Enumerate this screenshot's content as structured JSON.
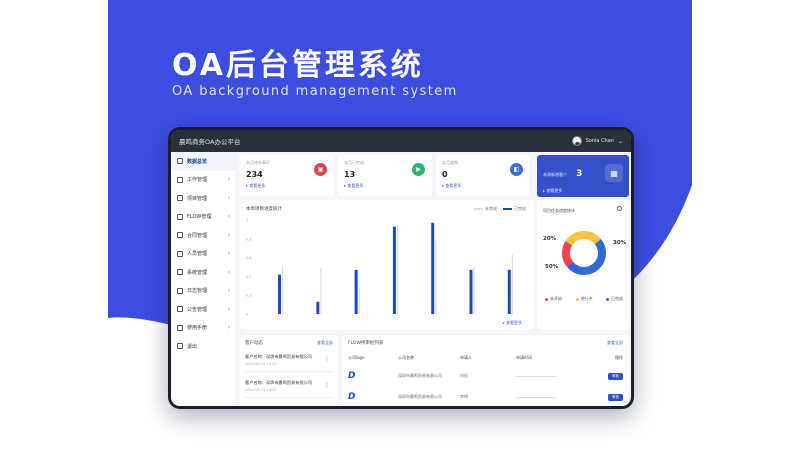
{
  "hero": {
    "title": "OA后台管理系统",
    "subtitle": "OA background management system"
  },
  "app": {
    "title": "晨鸣商务OA办公平台",
    "user": "Sonia Chan"
  },
  "sidebar": {
    "items": [
      {
        "label": "数据总览",
        "active": true,
        "arrow": ""
      },
      {
        "label": "工作管理",
        "arrow": "›"
      },
      {
        "label": "项目管理",
        "arrow": "›"
      },
      {
        "label": "FLOW管理",
        "arrow": "›"
      },
      {
        "label": "合同管理",
        "arrow": "›"
      },
      {
        "label": "人员管理",
        "arrow": "›"
      },
      {
        "label": "系统管理",
        "arrow": "›"
      },
      {
        "label": "日志管理",
        "arrow": "›"
      },
      {
        "label": "公告管理",
        "arrow": "›"
      },
      {
        "label": "使用手册",
        "arrow": "›"
      },
      {
        "label": "退出",
        "arrow": ""
      }
    ]
  },
  "stats": [
    {
      "label": "本月待办事项",
      "value": "234",
      "link": "▸ 查看更多",
      "color": "#e0454f",
      "glyph": "▣"
    },
    {
      "label": "本月已完成",
      "value": "13",
      "link": "▸ 查看更多",
      "color": "#2fb36d",
      "glyph": "▶"
    },
    {
      "label": "本月逾期",
      "value": "0",
      "link": "▸ 查看更多",
      "color": "#3a6fd8",
      "glyph": "◧"
    }
  ],
  "blue_card": {
    "label": "本周新增客户",
    "value": "3",
    "link": "▸ 查看更多",
    "glyph": "▦"
  },
  "chart_card": {
    "title": "本周项目进度统计",
    "legend": [
      "未完成",
      "已完成"
    ],
    "link": "▸ 查看更多"
  },
  "chart_data": [
    {
      "type": "bar",
      "title": "本周项目进度统计",
      "categories": [
        "1",
        "2",
        "3",
        "4",
        "5",
        "6",
        "7"
      ],
      "series": [
        {
          "name": "已完成",
          "values": [
            0.42,
            0.13,
            0.47,
            0.93,
            0.97,
            0.47,
            0.47
          ]
        },
        {
          "name": "未完成",
          "values": [
            0.52,
            0.49,
            0.28,
            0.95,
            0.78,
            0.5,
            0.63
          ]
        }
      ],
      "ylim": [
        0,
        1
      ],
      "yticks": [
        "1",
        "0.8",
        "0.6",
        "0.4",
        "0.2",
        "0"
      ],
      "colors": {
        "已完成": "#1f49b8",
        "未完成": "#d7dbe3"
      }
    },
    {
      "type": "pie",
      "title": "项目任务进度统计",
      "values": [
        20,
        30,
        50
      ],
      "labels": [
        "20%",
        "30%",
        "50%"
      ],
      "colors": [
        "#e74552",
        "#f5c242",
        "#3368d6"
      ],
      "legend": [
        "未开始",
        "进行中",
        "已完成"
      ]
    }
  ],
  "list_card": {
    "title": "客户动态",
    "link": "查看全部",
    "rows": [
      {
        "name": "客户名称：深圳市晨鸣贸易有限公司",
        "date": "2020-05-12 14:22",
        "more": "⋮"
      },
      {
        "name": "客户名称：深圳市晨鸣贸易有限公司",
        "date": "2020-05-12 14:22",
        "more": "⋮"
      }
    ]
  },
  "table_card": {
    "title": "FLOW待审批列表",
    "link": "查看全部",
    "headers": [
      "公司logo",
      "公司名称",
      "申请人",
      "申请时间",
      "操作"
    ],
    "rows": [
      {
        "logo": "D",
        "company": "深圳市晨鸣贸易有限公司",
        "applicant": "刘佳",
        "op": "审批"
      },
      {
        "logo": "D",
        "company": "深圳市晨鸣贸易有限公司",
        "applicant": "李明",
        "op": "审批"
      }
    ]
  }
}
